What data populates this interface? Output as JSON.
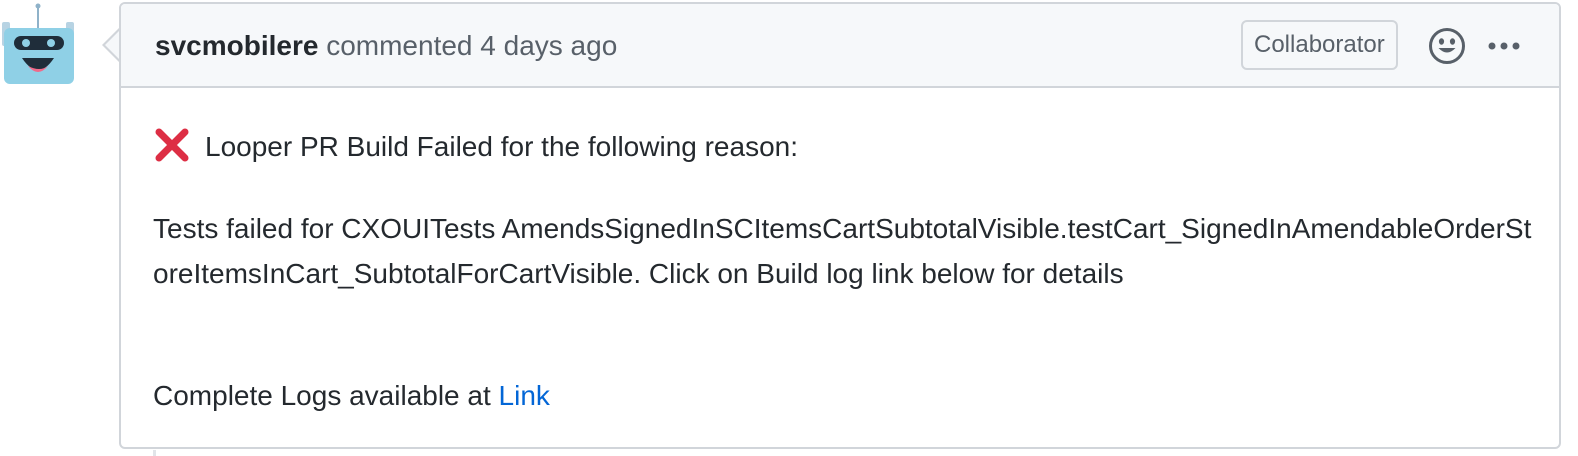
{
  "comment": {
    "author": "svcmobilere",
    "action": "commented",
    "time": "4 days ago",
    "badge": "Collaborator",
    "icons": {
      "avatar": "robot-avatar",
      "reaction": "smiley-icon",
      "more": "kebab-horizontal-icon",
      "status": "cross-mark-icon"
    },
    "body": {
      "status_text": "Looper PR Build Failed for the following reason:",
      "failure_text": "Tests failed for CXOUITests AmendsSignedInSCItemsCartSubtotalVisible.testCart_SignedInAmendableOrderStoreItemsInCart_SubtotalForCartVisible. Click on Build log link below for details",
      "logs_prefix": "Complete Logs available at",
      "logs_link": "Link"
    }
  },
  "colors": {
    "border": "#d1d5da",
    "header_bg": "#f6f8fa",
    "link": "#0366d6",
    "muted_text": "#586069",
    "error_red": "#dd2e44"
  }
}
